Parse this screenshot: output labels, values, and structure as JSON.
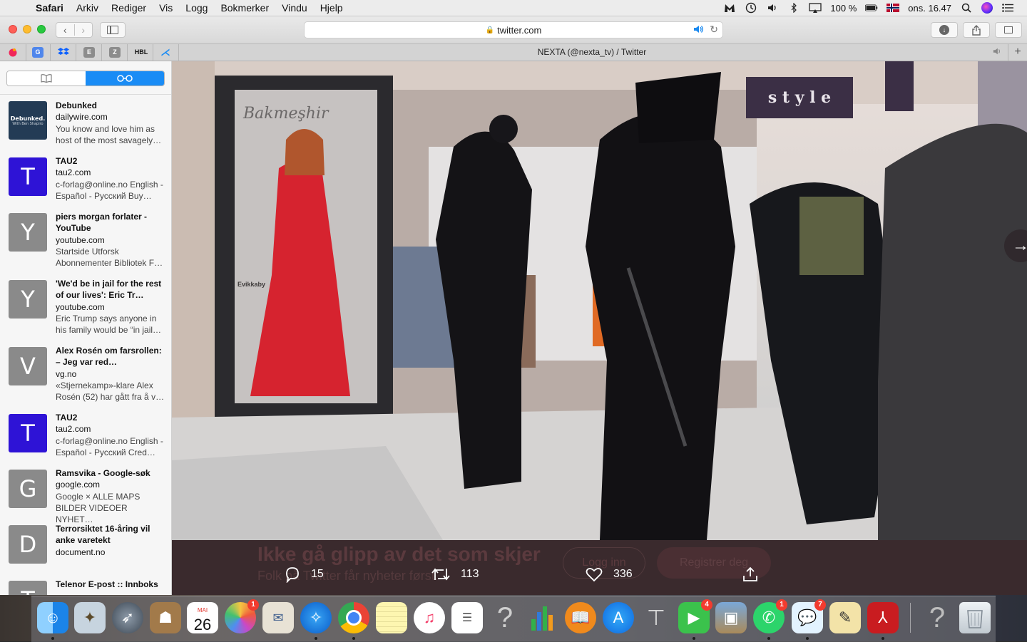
{
  "menubar": {
    "app": "Safari",
    "items": [
      "Arkiv",
      "Rediger",
      "Vis",
      "Logg",
      "Bokmerker",
      "Vindu",
      "Hjelp"
    ],
    "battery": "100 %",
    "clock": "ons. 16.47"
  },
  "toolbar": {
    "url": "twitter.com"
  },
  "tabbar": {
    "favorites": [
      "E",
      "Z",
      "HBL"
    ],
    "tab_title": "NEXTA (@nexta_tv) / Twitter"
  },
  "reading_list": {
    "items": [
      {
        "thumb": "Debunked.",
        "title": "Debunked",
        "domain": "dailywire.com",
        "desc": "You know and love him as host of the most savagely…"
      },
      {
        "thumb": "T",
        "title": "TAU2",
        "domain": "tau2.com",
        "desc": "c-forlag@online.no English - Español - Русский Buy…"
      },
      {
        "thumb": "Y",
        "title": "piers morgan forlater - YouTube",
        "domain": "youtube.com",
        "desc": "Startside Utforsk Abonnementer Bibliotek F…"
      },
      {
        "thumb": "Y",
        "title": "'We'd be in jail for the rest of our lives': Eric Tr…",
        "domain": "youtube.com",
        "desc": "Eric Trump says anyone in his family would be “in jail…"
      },
      {
        "thumb": "V",
        "title": "Alex Rosén om farsrollen: – Jeg var red…",
        "domain": "vg.no",
        "desc": "«Stjernekamp»-klare Alex Rosén (52) har gått fra å v…"
      },
      {
        "thumb": "T",
        "title": "TAU2",
        "domain": "tau2.com",
        "desc": "c-forlag@online.no English - Español - Русский Cred…"
      },
      {
        "thumb": "G",
        "title": "Ramsvika - Google-søk",
        "domain": "google.com",
        "desc": "Google × ALLE MAPS BILDER VIDEOER NYHET…"
      },
      {
        "thumb": "D",
        "title": "Terrorsiktet 16-åring vil anke varetekt",
        "domain": "document.no",
        "desc": ""
      },
      {
        "thumb": "T",
        "title": "Telenor E-post :: Innboks",
        "domain": "",
        "desc": ""
      }
    ],
    "debunked_sub": "With Ben Shapiro"
  },
  "video": {
    "sign_text": "s t y l e",
    "poster_script": "Bakmeşhir",
    "poster_brand": "Evikkaby"
  },
  "tweet_overlay": {
    "ghost_heading": "Ikke gå glipp av det som skjer",
    "ghost_sub": "Folk på Twitter får nyheter først.",
    "login": "Logg inn",
    "register": "Registrer deg",
    "replies": "15",
    "retweets": "113",
    "likes": "336"
  },
  "dock": {
    "calendar_month": "MAI",
    "calendar_day": "26",
    "photos_badge": "1",
    "facetime_badge": "4",
    "whatsapp_badge": "1",
    "messages_badge": "7"
  }
}
